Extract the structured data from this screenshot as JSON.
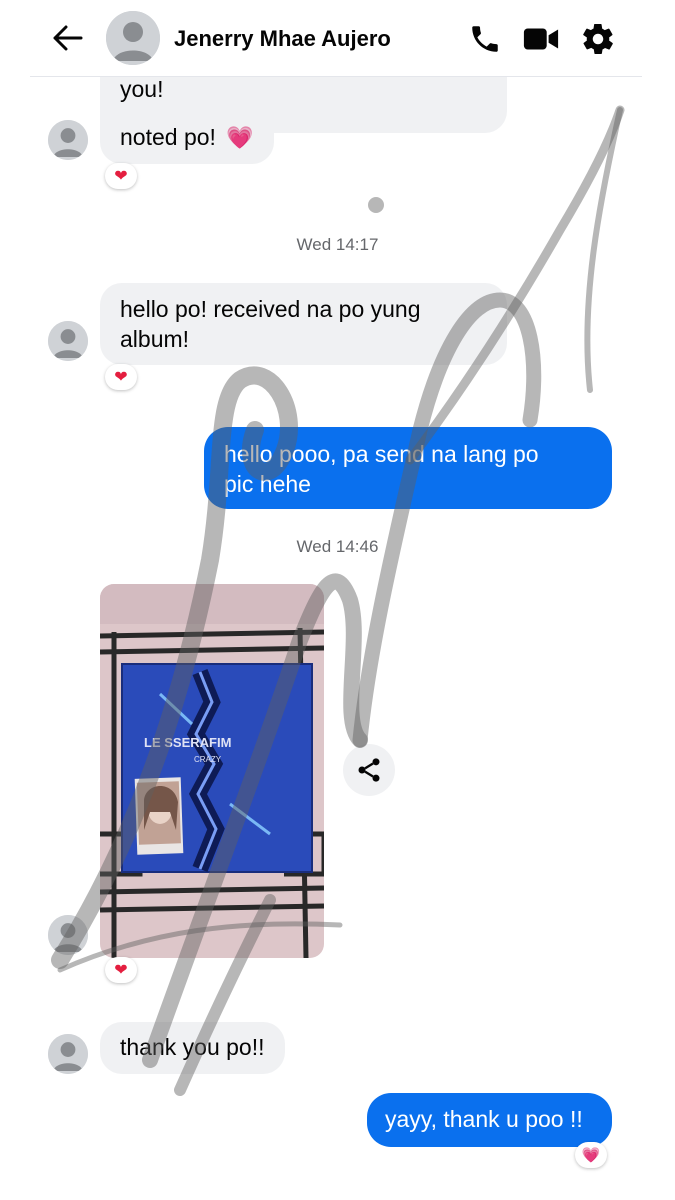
{
  "header": {
    "contact_name": "Jenerry Mhae Aujero",
    "icons": {
      "back": "arrow-left-icon",
      "call": "phone-icon",
      "video": "video-camera-icon",
      "settings": "gear-icon"
    }
  },
  "messages": {
    "partial_prev": "you!",
    "noted": "noted po!",
    "noted_emoji": "💗",
    "time_1": "Wed 14:17",
    "received_line1": "hello po! received na po yung",
    "received_line2": "album!",
    "out_1_line1": "hello pooo, pa send na lang po",
    "out_1_line2": "pic hehe",
    "time_2": "Wed 14:46",
    "thanks": "thank you po!!",
    "out_2": "yayy, thank u poo !!"
  },
  "photo": {
    "album_brand": "LE SSERAFIM",
    "album_title": "CRAZY"
  },
  "reactions": {
    "heart": "❤",
    "pink_heart": "💗"
  },
  "colors": {
    "outgoing_bubble": "#0a70ee",
    "incoming_bubble": "#f0f1f3",
    "heart_red": "#e41e3f",
    "header_icon": "#050505",
    "timestamp": "#65676b"
  }
}
